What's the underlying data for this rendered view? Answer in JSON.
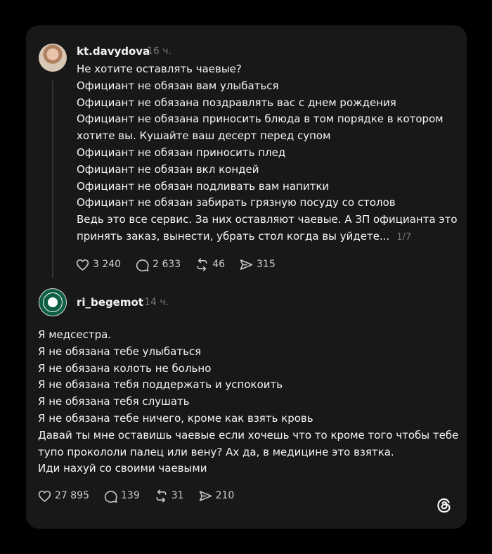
{
  "posts": [
    {
      "username": "kt.davydova",
      "time": "16 ч.",
      "lines": [
        "Не хотите оставлять чаевые?",
        "Официант не обязан вам улыбаться",
        "Официант не обязана поздравлять вас с днем рождения",
        "Официант не обязана приносить блюда в том порядке в котором",
        "хотите вы. Кушайте ваш десерт перед супом",
        "Официант не обязан приносить плед",
        "Официант не обязан вкл кондей",
        "Официант не обязан подливать вам напитки",
        "Официант не обязан забирать грязную посуду со столов",
        "Ведь это все сервис. За них оставляют чаевые. А ЗП официанта это",
        "принять заказ, вынести, убрать стол когда вы уйдете..."
      ],
      "pager": "1/7",
      "stats": {
        "likes": "3 240",
        "replies": "2 633",
        "reposts": "46",
        "shares": "315"
      }
    },
    {
      "username": "ri_begemot",
      "time": "14 ч.",
      "lines": [
        "Я медсестра.",
        "Я не обязана тебе улыбаться",
        "Я не обязана колоть не больно",
        "Я не обязана тебя поддержать и успокоить",
        "Я не обязана тебя слушать",
        "Я не обязана тебе ничего, кроме как взять кровь",
        "Давай ты мне оставишь чаевые если хочешь что то кроме того чтобы тебе",
        "тупо прокололи палец или вену? Ах да, в медицине это взятка.",
        "Иди нахуй со своими чаевыми"
      ],
      "stats": {
        "likes": "27 895",
        "replies": "139",
        "reposts": "31",
        "shares": "210"
      }
    }
  ],
  "icons": {
    "like": "heart-icon",
    "reply": "speech-bubble-icon",
    "repost": "repost-icon",
    "share": "paper-plane-icon",
    "brand": "threads-logo-icon"
  },
  "colors": {
    "page_background": "#000000",
    "card_background": "#181818",
    "text_primary": "#f3f5f7",
    "text_secondary": "#777777"
  }
}
